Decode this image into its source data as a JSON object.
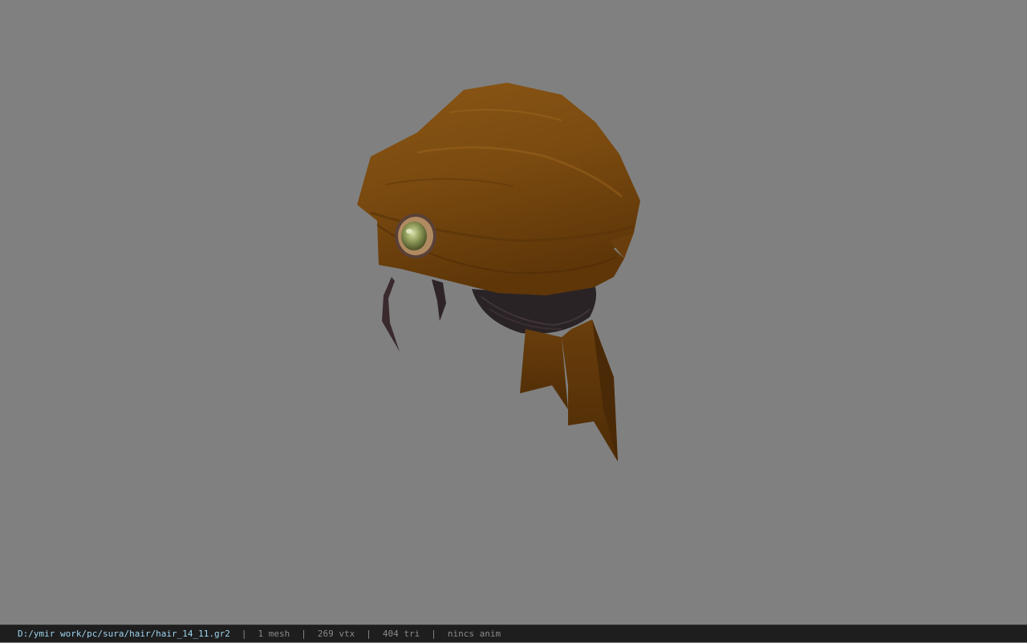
{
  "status_bar": {
    "file_path": "D:/ymir work/pc/sura/hair/hair_14_11.gr2",
    "separator": "|",
    "mesh_info": "1 mesh",
    "vertex_info": "269 vtx",
    "triangle_info": "404 tri",
    "anim_info": "nincs anim"
  },
  "viewport": {
    "background_color": "#808080",
    "model_colors": {
      "bandana_main": "#7a4a10",
      "bandana_dark": "#5a3408",
      "bandana_light": "#8e5a18",
      "hair_dark": "#2a2326",
      "gem": "#9aa860"
    }
  }
}
